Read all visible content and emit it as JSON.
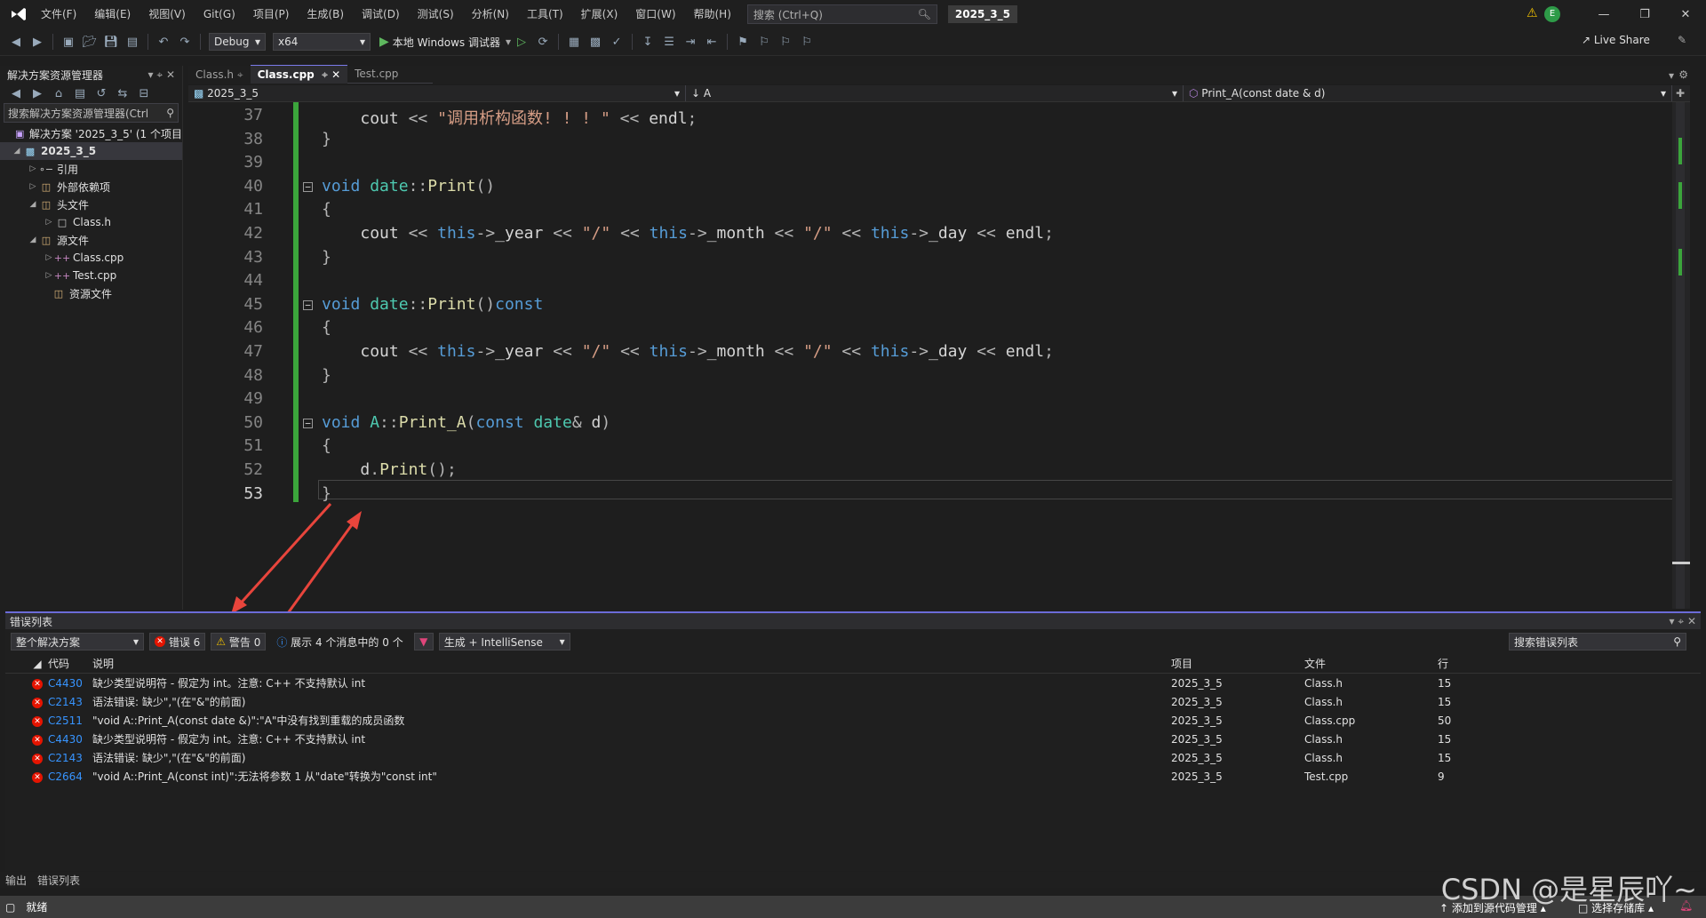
{
  "menu": [
    "文件(F)",
    "编辑(E)",
    "视图(V)",
    "Git(G)",
    "项目(P)",
    "生成(B)",
    "调试(D)",
    "测试(S)",
    "分析(N)",
    "工具(T)",
    "扩展(X)",
    "窗口(W)",
    "帮助(H)"
  ],
  "search": {
    "placeholder": "搜索 (Ctrl+Q)"
  },
  "solution_name": "2025_3_5",
  "toolbar": {
    "config": "Debug",
    "platform": "x64",
    "run_label": "本地 Windows 调试器",
    "live_share": "Live Share"
  },
  "solution_explorer": {
    "title": "解决方案资源管理器",
    "search": "搜索解决方案资源管理器(Ctrl",
    "tree": [
      {
        "label": "解决方案 '2025_3_5' (1 个项目",
        "indent": 0
      },
      {
        "label": "2025_3_5",
        "indent": 1
      },
      {
        "label": "引用",
        "indent": 2
      },
      {
        "label": "外部依赖项",
        "indent": 2
      },
      {
        "label": "头文件",
        "indent": 2
      },
      {
        "label": "Class.h",
        "indent": 3
      },
      {
        "label": "源文件",
        "indent": 2
      },
      {
        "label": "Class.cpp",
        "indent": 3
      },
      {
        "label": "Test.cpp",
        "indent": 3
      },
      {
        "label": "资源文件",
        "indent": 2
      }
    ]
  },
  "tabs": [
    {
      "label": "Class.h",
      "active": false
    },
    {
      "label": "Class.cpp",
      "active": true
    },
    {
      "label": "Test.cpp",
      "active": false
    }
  ],
  "navbar": {
    "project": "2025_3_5",
    "scope": "A",
    "member": "Print_A(const date & d)"
  },
  "editor": {
    "lines": [
      {
        "n": "37",
        "text": "    cout << \"调用析构函数! ! ! \" << endl;"
      },
      {
        "n": "38",
        "text": "}"
      },
      {
        "n": "39",
        "text": ""
      },
      {
        "n": "40",
        "text": "void date::Print()"
      },
      {
        "n": "41",
        "text": "{"
      },
      {
        "n": "42",
        "text": "    cout << this->_year << \"/\" << this->_month << \"/\" << this->_day << endl;"
      },
      {
        "n": "43",
        "text": "}"
      },
      {
        "n": "44",
        "text": ""
      },
      {
        "n": "45",
        "text": "void date::Print()const"
      },
      {
        "n": "46",
        "text": "{"
      },
      {
        "n": "47",
        "text": "    cout << this->_year << \"/\" << this->_month << \"/\" << this->_day << endl;"
      },
      {
        "n": "48",
        "text": "}"
      },
      {
        "n": "49",
        "text": ""
      },
      {
        "n": "50",
        "text": "void A::Print_A(const date& d)"
      },
      {
        "n": "51",
        "text": "{"
      },
      {
        "n": "52",
        "text": "    d.Print();"
      },
      {
        "n": "53",
        "text": "}"
      }
    ]
  },
  "error_list": {
    "title": "错误列表",
    "scope": "整个解决方案",
    "errors_btn": "错误 6",
    "warnings_btn": "警告 0",
    "messages_btn": "展示 4 个消息中的 0 个",
    "build_filter": "生成 + IntelliSense",
    "search_placeholder": "搜索错误列表",
    "columns": {
      "code": "代码",
      "desc": "说明",
      "project": "项目",
      "file": "文件",
      "line": "行"
    },
    "rows": [
      {
        "code": "C4430",
        "desc": "缺少类型说明符 - 假定为 int。注意: C++ 不支持默认 int",
        "project": "2025_3_5",
        "file": "Class.h",
        "line": "15"
      },
      {
        "code": "C2143",
        "desc": "语法错误: 缺少\",\"(在\"&\"的前面)",
        "project": "2025_3_5",
        "file": "Class.h",
        "line": "15"
      },
      {
        "code": "C2511",
        "desc": "\"void A::Print_A(const date &)\":\"A\"中没有找到重载的成员函数",
        "project": "2025_3_5",
        "file": "Class.cpp",
        "line": "50"
      },
      {
        "code": "C4430",
        "desc": "缺少类型说明符 - 假定为 int。注意: C++ 不支持默认 int",
        "project": "2025_3_5",
        "file": "Class.h",
        "line": "15"
      },
      {
        "code": "C2143",
        "desc": "语法错误: 缺少\",\"(在\"&\"的前面)",
        "project": "2025_3_5",
        "file": "Class.h",
        "line": "15"
      },
      {
        "code": "C2664",
        "desc": "\"void A::Print_A(const int)\":无法将参数 1 从\"date\"转换为\"const int\"",
        "project": "2025_3_5",
        "file": "Test.cpp",
        "line": "9"
      }
    ]
  },
  "bottom_tabs": [
    "输出",
    "错误列表"
  ],
  "status": {
    "ready": "就绪",
    "add_source": "添加到源代码管理",
    "select_repo": "选择存储库"
  },
  "watermark": "CSDN @是星辰吖~",
  "colors": {
    "accent": "#6b6bd8",
    "error": "#e51400",
    "changebar": "#3ba53b"
  }
}
